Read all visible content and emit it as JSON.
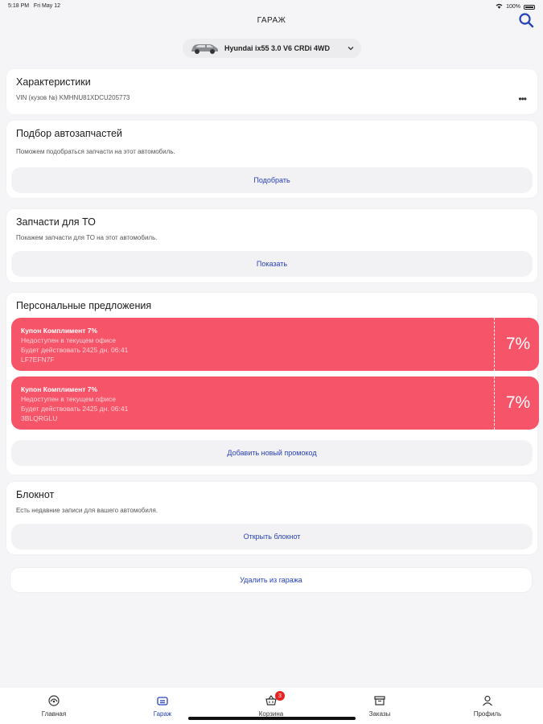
{
  "status_bar": {
    "time": "5:18 PM",
    "date": "Fri May 12",
    "battery": "100%"
  },
  "header": {
    "title": "ГАРАЖ"
  },
  "car": {
    "name": "Hyundai ix55 3.0 V6 CRDi 4WD"
  },
  "characteristics": {
    "title": "Характеристики",
    "vin": "VIN (кузов №) KMHNU81XDCU205773",
    "more": "•••"
  },
  "parts_selection": {
    "title": "Подбор автозапчастей",
    "subtitle": "Поможем подобраться запчасти на этот автомобиль.",
    "button": "Подобрать"
  },
  "maintenance_parts": {
    "title": "Запчасти для ТО",
    "subtitle": "Покажем запчасти для ТО на этот автомобиль.",
    "button": "Показать"
  },
  "offers": {
    "title": "Персональные предложения",
    "coupons": [
      {
        "title": "Купон Комплимент 7%",
        "line1": "Недоступен в текущем офисе",
        "line2": "Будет действовать 2425 дн. 06:41",
        "code": "LF7EFN7F",
        "percent": "7%"
      },
      {
        "title": "Купон Комплимент 7%",
        "line1": "Недоступен в текущем офисе",
        "line2": "Будет действовать 2425 дн. 06:41",
        "code": "3BLQRGLU",
        "percent": "7%"
      }
    ],
    "button": "Добавить новый промокод"
  },
  "notebook": {
    "title": "Блокнот",
    "subtitle": "Есть недавние записи для вашего автомобиля.",
    "button": "Открыть блокнот"
  },
  "remove_button": "Удалить из гаража",
  "tabbar": {
    "items": [
      {
        "label": "Главная",
        "icon": "home-icon"
      },
      {
        "label": "Гараж",
        "icon": "garage-icon"
      },
      {
        "label": "Корзина",
        "icon": "cart-icon",
        "badge": "3"
      },
      {
        "label": "Заказы",
        "icon": "orders-icon"
      },
      {
        "label": "Профиль",
        "icon": "profile-icon"
      }
    ]
  },
  "colors": {
    "accent": "#2741b8",
    "coupon": "#f65468",
    "badge": "#e52323"
  }
}
